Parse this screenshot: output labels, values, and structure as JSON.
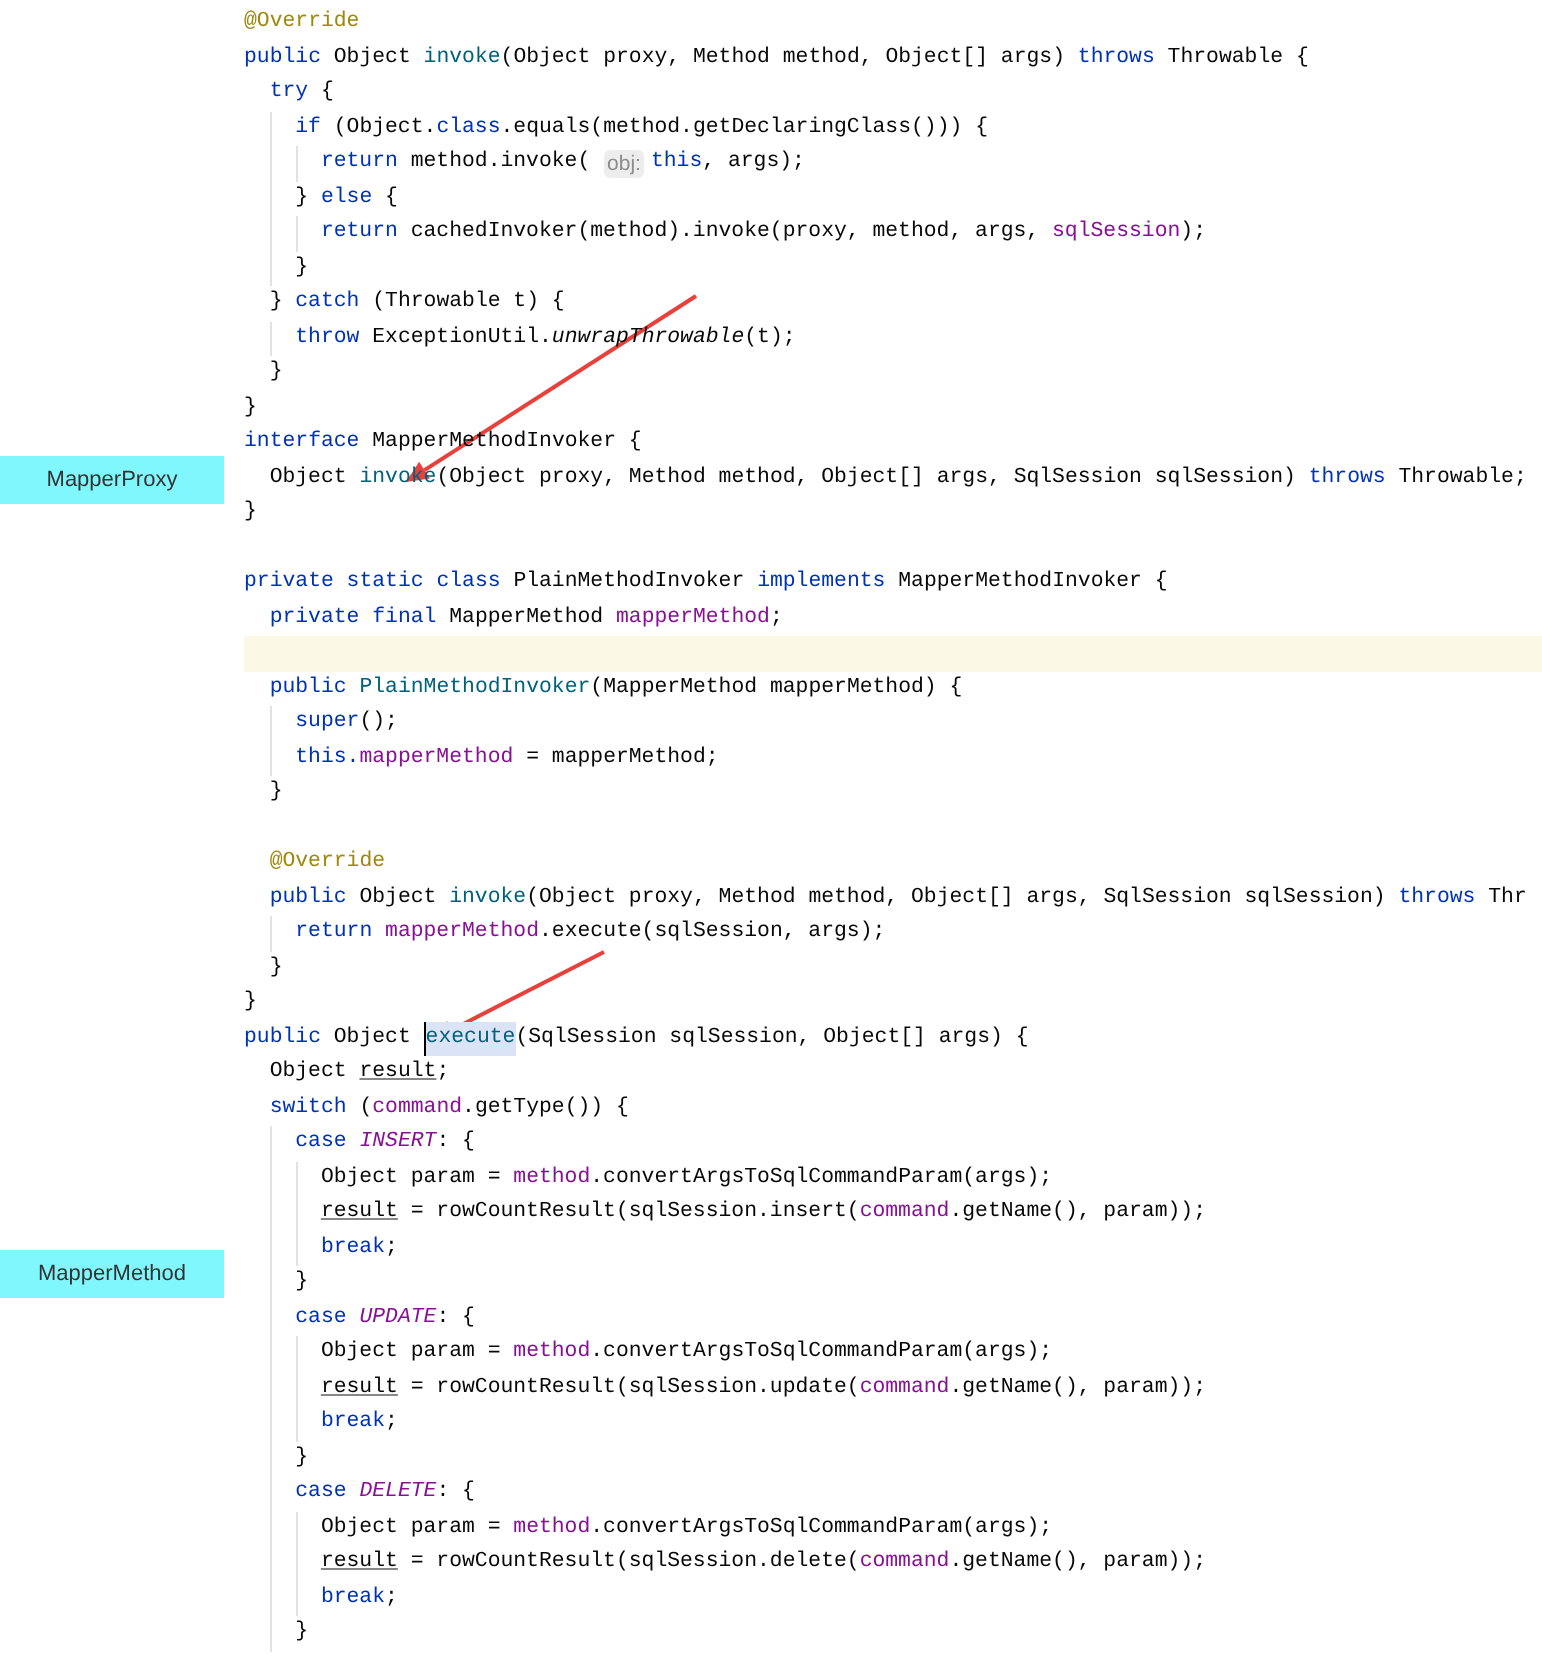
{
  "labels": [
    {
      "text": "MapperProxy"
    },
    {
      "text": "MapperMethod"
    }
  ],
  "code": [
    {
      "current": false,
      "tokens": [
        {
          "kind": "annotation",
          "text": "@Override"
        }
      ]
    },
    {
      "current": false,
      "tokens": [
        {
          "kind": "keyword",
          "text": "public"
        },
        {
          "kind": "plain",
          "text": " Object "
        },
        {
          "kind": "declaration",
          "text": "invoke"
        },
        {
          "kind": "plain",
          "text": "(Object proxy, Method method, Object[] args) "
        },
        {
          "kind": "keyword",
          "text": "throws"
        },
        {
          "kind": "plain",
          "text": " Throwable {"
        }
      ],
      "children": [
        {
          "current": false,
          "tokens": [
            {
              "kind": "keyword",
              "text": "try"
            },
            {
              "kind": "plain",
              "text": " {"
            }
          ],
          "children": [
            {
              "current": false,
              "tokens": [
                {
                  "kind": "keyword",
                  "text": "if"
                },
                {
                  "kind": "plain",
                  "text": " (Object."
                },
                {
                  "kind": "keyword",
                  "text": "class"
                },
                {
                  "kind": "plain",
                  "text": ".equals(method.getDeclaringClass())) {"
                }
              ],
              "children": [
                {
                  "current": false,
                  "tokens": [
                    {
                      "kind": "keyword",
                      "text": "return"
                    },
                    {
                      "kind": "plain",
                      "text": " method.invoke( "
                    },
                    {
                      "kind": "hint",
                      "text": "obj:"
                    },
                    {
                      "kind": "keyword",
                      "text": "this"
                    },
                    {
                      "kind": "plain",
                      "text": ", args);"
                    }
                  ]
                }
              ]
            },
            {
              "current": false,
              "tokens": [
                {
                  "kind": "plain",
                  "text": "} "
                },
                {
                  "kind": "keyword",
                  "text": "else"
                },
                {
                  "kind": "plain",
                  "text": " {"
                }
              ],
              "children": [
                {
                  "current": false,
                  "tokens": [
                    {
                      "kind": "keyword",
                      "text": "return"
                    },
                    {
                      "kind": "plain",
                      "text": " cachedInvoker(method).invoke(proxy, method, args, "
                    },
                    {
                      "kind": "field",
                      "text": "sqlSession"
                    },
                    {
                      "kind": "plain",
                      "text": ");"
                    }
                  ]
                }
              ]
            },
            {
              "current": false,
              "tokens": [
                {
                  "kind": "plain",
                  "text": "}"
                }
              ]
            }
          ]
        },
        {
          "current": false,
          "tokens": [
            {
              "kind": "plain",
              "text": "} "
            },
            {
              "kind": "keyword",
              "text": "catch"
            },
            {
              "kind": "plain",
              "text": " (Throwable t) {"
            }
          ],
          "children": [
            {
              "current": false,
              "tokens": [
                {
                  "kind": "keyword",
                  "text": "throw"
                },
                {
                  "kind": "plain",
                  "text": " ExceptionUtil."
                },
                {
                  "kind": "italic",
                  "text": "unwrapThrowable"
                },
                {
                  "kind": "plain",
                  "text": "(t);"
                }
              ]
            }
          ]
        },
        {
          "current": false,
          "tokens": [
            {
              "kind": "plain",
              "text": "}"
            }
          ]
        }
      ]
    },
    {
      "current": false,
      "tokens": [
        {
          "kind": "plain",
          "text": "}"
        }
      ]
    },
    {
      "current": false,
      "tokens": [
        {
          "kind": "keyword",
          "text": "interface"
        },
        {
          "kind": "plain",
          "text": " MapperMethodInvoker {"
        }
      ],
      "children": [
        {
          "current": false,
          "tokens": [
            {
              "kind": "plain",
              "text": "Object "
            },
            {
              "kind": "declaration",
              "text": "invoke"
            },
            {
              "kind": "plain",
              "text": "(Object proxy, Method method, Object[] args, SqlSession sqlSession) "
            },
            {
              "kind": "keyword",
              "text": "throws"
            },
            {
              "kind": "plain",
              "text": " Throwable;"
            }
          ]
        }
      ]
    },
    {
      "current": false,
      "tokens": [
        {
          "kind": "plain",
          "text": "}"
        }
      ]
    },
    {
      "current": false
    },
    {
      "current": false,
      "tokens": [
        {
          "kind": "keyword",
          "text": "private static class"
        },
        {
          "kind": "plain",
          "text": " PlainMethodInvoker "
        },
        {
          "kind": "keyword",
          "text": "implements"
        },
        {
          "kind": "plain",
          "text": " MapperMethodInvoker {"
        }
      ],
      "children": [
        {
          "current": false,
          "tokens": [
            {
              "kind": "keyword",
              "text": "private final"
            },
            {
              "kind": "plain",
              "text": " MapperMethod "
            },
            {
              "kind": "field",
              "text": "mapperMethod"
            },
            {
              "kind": "plain",
              "text": ";"
            }
          ]
        },
        {
          "current": true
        },
        {
          "current": false,
          "tokens": [
            {
              "kind": "keyword",
              "text": "public "
            },
            {
              "kind": "declaration",
              "text": "PlainMethodInvoker"
            },
            {
              "kind": "plain",
              "text": "(MapperMethod mapperMethod) {"
            }
          ],
          "children": [
            {
              "current": false,
              "tokens": [
                {
                  "kind": "keyword",
                  "text": "super"
                },
                {
                  "kind": "plain",
                  "text": "();"
                }
              ]
            },
            {
              "current": false,
              "tokens": [
                {
                  "kind": "keyword",
                  "text": "this."
                },
                {
                  "kind": "field",
                  "text": "mapperMethod"
                },
                {
                  "kind": "plain",
                  "text": " = mapperMethod;"
                }
              ]
            }
          ]
        },
        {
          "current": false,
          "tokens": [
            {
              "kind": "plain",
              "text": "}"
            }
          ]
        },
        {
          "current": false
        },
        {
          "current": false,
          "tokens": [
            {
              "kind": "annotation",
              "text": "@Override"
            }
          ]
        },
        {
          "current": false,
          "tokens": [
            {
              "kind": "keyword",
              "text": "public"
            },
            {
              "kind": "plain",
              "text": " Object "
            },
            {
              "kind": "declaration",
              "text": "invoke"
            },
            {
              "kind": "plain",
              "text": "(Object proxy, Method method, Object[] args, SqlSession sqlSession) "
            },
            {
              "kind": "keyword",
              "text": "throws"
            },
            {
              "kind": "plain",
              "text": " Thr"
            }
          ],
          "children": [
            {
              "current": false,
              "tokens": [
                {
                  "kind": "keyword",
                  "text": "return "
                },
                {
                  "kind": "field",
                  "text": "mapperMethod"
                },
                {
                  "kind": "plain",
                  "text": ".execute(sqlSession, args);"
                }
              ]
            }
          ]
        },
        {
          "current": false,
          "tokens": [
            {
              "kind": "plain",
              "text": "}"
            }
          ]
        }
      ]
    },
    {
      "current": false,
      "tokens": [
        {
          "kind": "plain",
          "text": "}"
        }
      ]
    },
    {
      "current": false,
      "tokens": [
        {
          "kind": "keyword",
          "text": "public"
        },
        {
          "kind": "plain",
          "text": " Object "
        },
        {
          "kind": "selected",
          "text": "execute"
        },
        {
          "kind": "plain",
          "text": "(SqlSession sqlSession, Object[] args) {"
        }
      ],
      "children": [
        {
          "current": false,
          "tokens": [
            {
              "kind": "plain",
              "text": "Object "
            },
            {
              "kind": "reassigned",
              "text": "result"
            },
            {
              "kind": "plain",
              "text": ";"
            }
          ]
        },
        {
          "current": false,
          "tokens": [
            {
              "kind": "keyword",
              "text": "switch"
            },
            {
              "kind": "plain",
              "text": " ("
            },
            {
              "kind": "field",
              "text": "command"
            },
            {
              "kind": "plain",
              "text": ".getType()) {"
            }
          ],
          "children": [
            {
              "current": false,
              "tokens": [
                {
                  "kind": "keyword",
                  "text": "case "
                },
                {
                  "kind": "constant",
                  "text": "INSERT"
                },
                {
                  "kind": "plain",
                  "text": ": {"
                }
              ],
              "children": [
                {
                  "current": false,
                  "tokens": [
                    {
                      "kind": "plain",
                      "text": "Object param = "
                    },
                    {
                      "kind": "field",
                      "text": "method"
                    },
                    {
                      "kind": "plain",
                      "text": ".convertArgsToSqlCommandParam(args);"
                    }
                  ]
                },
                {
                  "current": false,
                  "tokens": [
                    {
                      "kind": "reassigned",
                      "text": "result"
                    },
                    {
                      "kind": "plain",
                      "text": " = rowCountResult(sqlSession.insert("
                    },
                    {
                      "kind": "field",
                      "text": "command"
                    },
                    {
                      "kind": "plain",
                      "text": ".getName(), param));"
                    }
                  ]
                },
                {
                  "current": false,
                  "tokens": [
                    {
                      "kind": "keyword",
                      "text": "break"
                    },
                    {
                      "kind": "plain",
                      "text": ";"
                    }
                  ]
                }
              ]
            },
            {
              "current": false,
              "tokens": [
                {
                  "kind": "plain",
                  "text": "}"
                }
              ]
            },
            {
              "current": false,
              "tokens": [
                {
                  "kind": "keyword",
                  "text": "case "
                },
                {
                  "kind": "constant",
                  "text": "UPDATE"
                },
                {
                  "kind": "plain",
                  "text": ": {"
                }
              ],
              "children": [
                {
                  "current": false,
                  "tokens": [
                    {
                      "kind": "plain",
                      "text": "Object param = "
                    },
                    {
                      "kind": "field",
                      "text": "method"
                    },
                    {
                      "kind": "plain",
                      "text": ".convertArgsToSqlCommandParam(args);"
                    }
                  ]
                },
                {
                  "current": false,
                  "tokens": [
                    {
                      "kind": "reassigned",
                      "text": "result"
                    },
                    {
                      "kind": "plain",
                      "text": " = rowCountResult(sqlSession.update("
                    },
                    {
                      "kind": "field",
                      "text": "command"
                    },
                    {
                      "kind": "plain",
                      "text": ".getName(), param));"
                    }
                  ]
                },
                {
                  "current": false,
                  "tokens": [
                    {
                      "kind": "keyword",
                      "text": "break"
                    },
                    {
                      "kind": "plain",
                      "text": ";"
                    }
                  ]
                }
              ]
            },
            {
              "current": false,
              "tokens": [
                {
                  "kind": "plain",
                  "text": "}"
                }
              ]
            },
            {
              "current": false,
              "tokens": [
                {
                  "kind": "keyword",
                  "text": "case "
                },
                {
                  "kind": "constant",
                  "text": "DELETE"
                },
                {
                  "kind": "plain",
                  "text": ": {"
                }
              ],
              "children": [
                {
                  "current": false,
                  "tokens": [
                    {
                      "kind": "plain",
                      "text": "Object param = "
                    },
                    {
                      "kind": "field",
                      "text": "method"
                    },
                    {
                      "kind": "plain",
                      "text": ".convertArgsToSqlCommandParam(args);"
                    }
                  ]
                },
                {
                  "current": false,
                  "tokens": [
                    {
                      "kind": "reassigned",
                      "text": "result"
                    },
                    {
                      "kind": "plain",
                      "text": " = rowCountResult(sqlSession.delete("
                    },
                    {
                      "kind": "field",
                      "text": "command"
                    },
                    {
                      "kind": "plain",
                      "text": ".getName(), param));"
                    }
                  ]
                },
                {
                  "current": false,
                  "tokens": [
                    {
                      "kind": "keyword",
                      "text": "break"
                    },
                    {
                      "kind": "plain",
                      "text": ";"
                    }
                  ]
                }
              ]
            },
            {
              "current": false,
              "tokens": [
                {
                  "kind": "plain",
                  "text": "}"
                }
              ]
            }
          ]
        }
      ]
    }
  ]
}
